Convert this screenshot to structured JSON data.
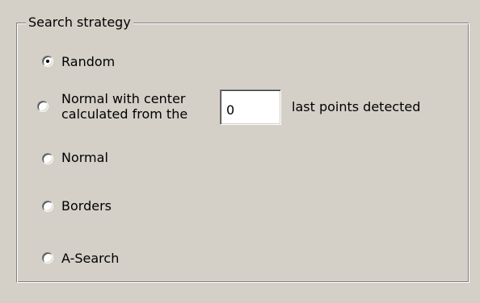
{
  "groupbox": {
    "title": "Search strategy"
  },
  "options": {
    "random": {
      "label": "Random",
      "selected": true
    },
    "normal_center": {
      "label_line1": "Normal with center",
      "label_line2": "calculated from the",
      "suffix": "last points detected",
      "input_value": "0",
      "selected": false
    },
    "normal": {
      "label": "Normal",
      "selected": false
    },
    "borders": {
      "label": "Borders",
      "selected": false
    },
    "a_search": {
      "label": "A-Search",
      "selected": false
    }
  }
}
